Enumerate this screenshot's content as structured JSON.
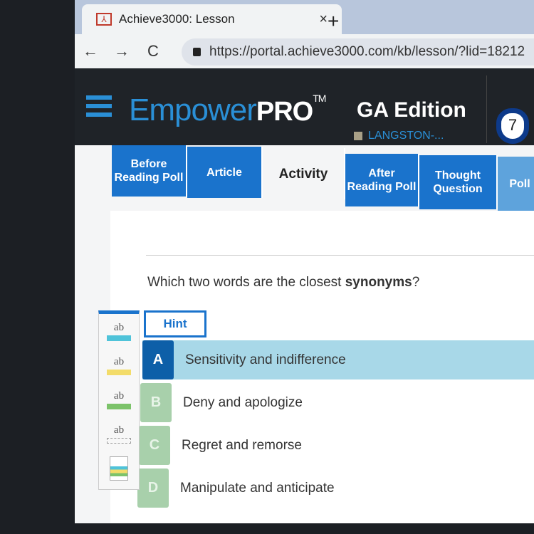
{
  "browser": {
    "tab_title": "Achieve3000: Lesson",
    "close": "×",
    "new_tab": "+",
    "back": "←",
    "forward": "→",
    "reload": "C",
    "url": "https://portal.achieve3000.com/kb/lesson/?lid=18212"
  },
  "header": {
    "logo_light": "Empower",
    "logo_bold": "PRO",
    "tm": "TM",
    "edition": "GA Edition",
    "school": "LANGSTON-...",
    "level": "7"
  },
  "tabs": [
    {
      "label": "Before Reading Poll"
    },
    {
      "label": "Article"
    },
    {
      "label": "Activity",
      "active": true
    },
    {
      "label": "After Reading Poll"
    },
    {
      "label": "Thought Question"
    },
    {
      "label": "Poll R"
    }
  ],
  "question": {
    "text_pre": "Which two words are the closest ",
    "text_bold": "synonyms",
    "text_post": "?",
    "hint": "Hint"
  },
  "options": [
    {
      "letter": "A",
      "text": "Sensitivity and indifference",
      "selected": true
    },
    {
      "letter": "B",
      "text": "Deny and apologize"
    },
    {
      "letter": "C",
      "text": "Regret and remorse"
    },
    {
      "letter": "D",
      "text": "Manipulate and anticipate"
    }
  ],
  "tools": [
    {
      "label": "ab",
      "color": "#4fc3d9"
    },
    {
      "label": "ab",
      "color": "#f3dc6a"
    },
    {
      "label": "ab",
      "color": "#7cc36a"
    },
    {
      "label": "ab",
      "color": "dashed"
    },
    {
      "label": "",
      "color": "notes"
    }
  ],
  "colors": {
    "accent": "#1a73cc",
    "header": "#1f2328",
    "selected": "#a8d8e8"
  }
}
